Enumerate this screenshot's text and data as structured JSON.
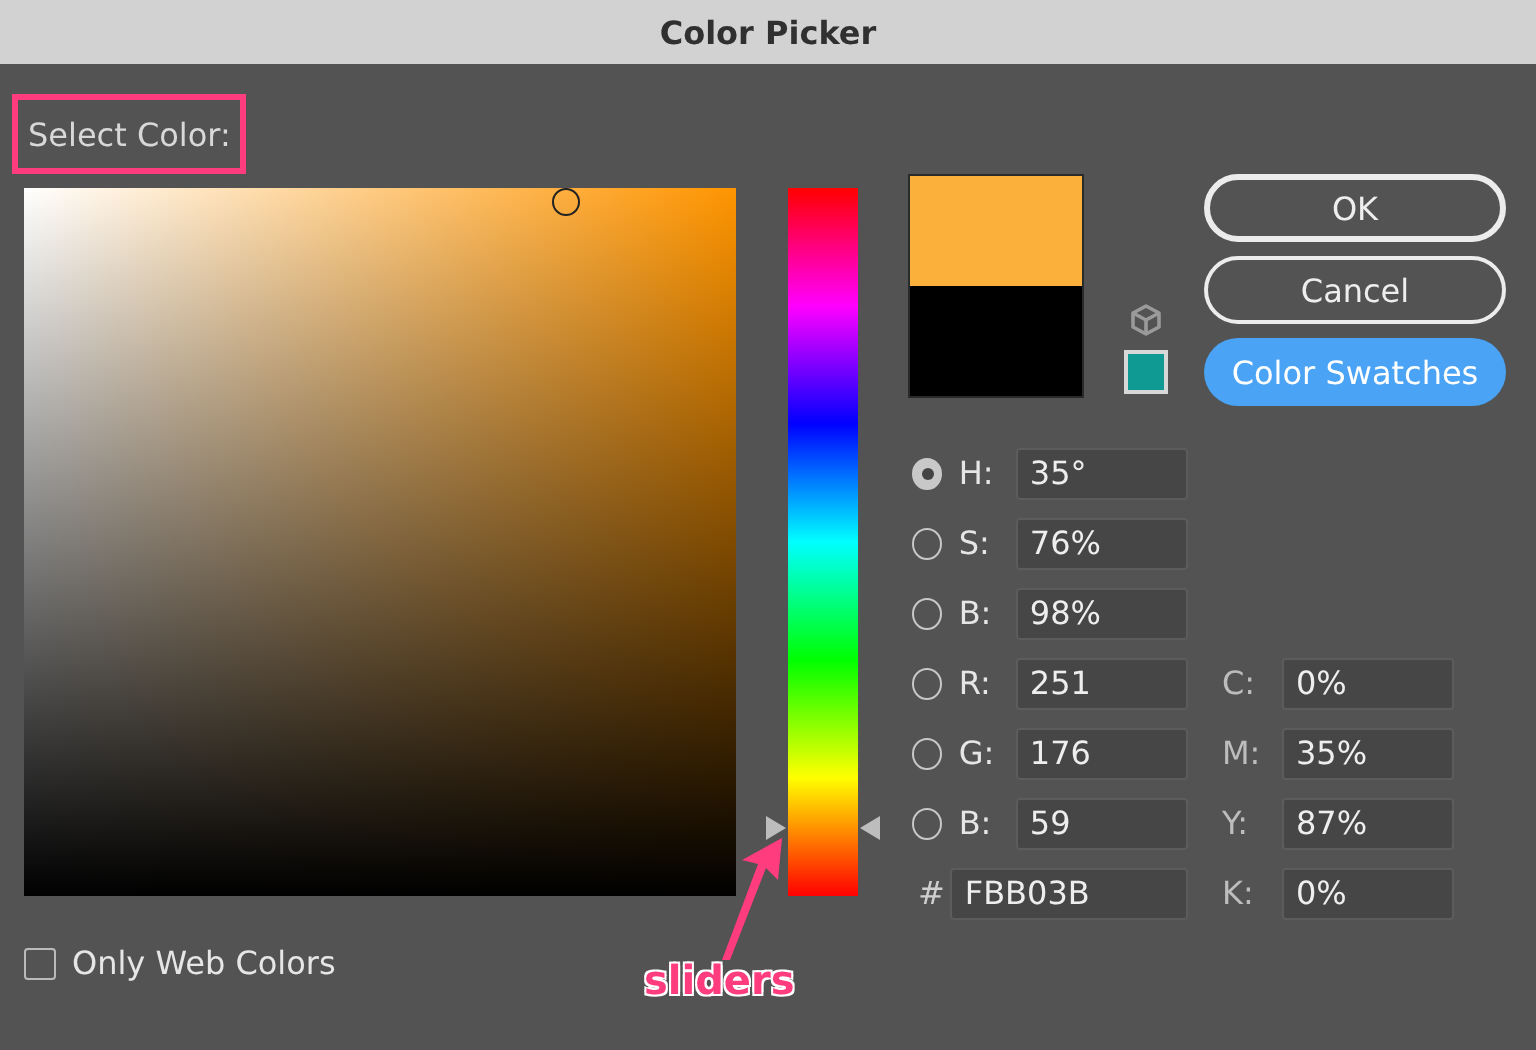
{
  "window": {
    "title": "Color Picker"
  },
  "select_label": {
    "text": "Select Color:",
    "highlighted": true
  },
  "hue_slider": {
    "level": 0.097
  },
  "buttons": [
    {
      "label": "OK",
      "kind": "outline"
    },
    {
      "label": "Cancel",
      "kind": "outline"
    },
    {
      "label": "Color Swatches",
      "kind": "primary"
    }
  ],
  "hsb_rgb_fields": [
    {
      "label": "H:",
      "value": "35°",
      "selected": true
    },
    {
      "label": "S:",
      "value": "76%",
      "selected": false
    },
    {
      "label": "B:",
      "value": "98%",
      "selected": false
    },
    {
      "label": "R:",
      "value": "251",
      "selected": false
    },
    {
      "label": "G:",
      "value": "176",
      "selected": false
    },
    {
      "label": "B:",
      "value": "59",
      "selected": false
    }
  ],
  "hex_field": {
    "label": "#",
    "value": "FBB03B"
  },
  "cmyk_fields": [
    {
      "label": "C:",
      "value": "0%"
    },
    {
      "label": "M:",
      "value": "35%"
    },
    {
      "label": "Y:",
      "value": "87%"
    },
    {
      "label": "K:",
      "value": "0%"
    }
  ],
  "only_web_colors": {
    "label": "Only Web Colors",
    "checked": false
  },
  "annotation": {
    "text": "sliders"
  }
}
